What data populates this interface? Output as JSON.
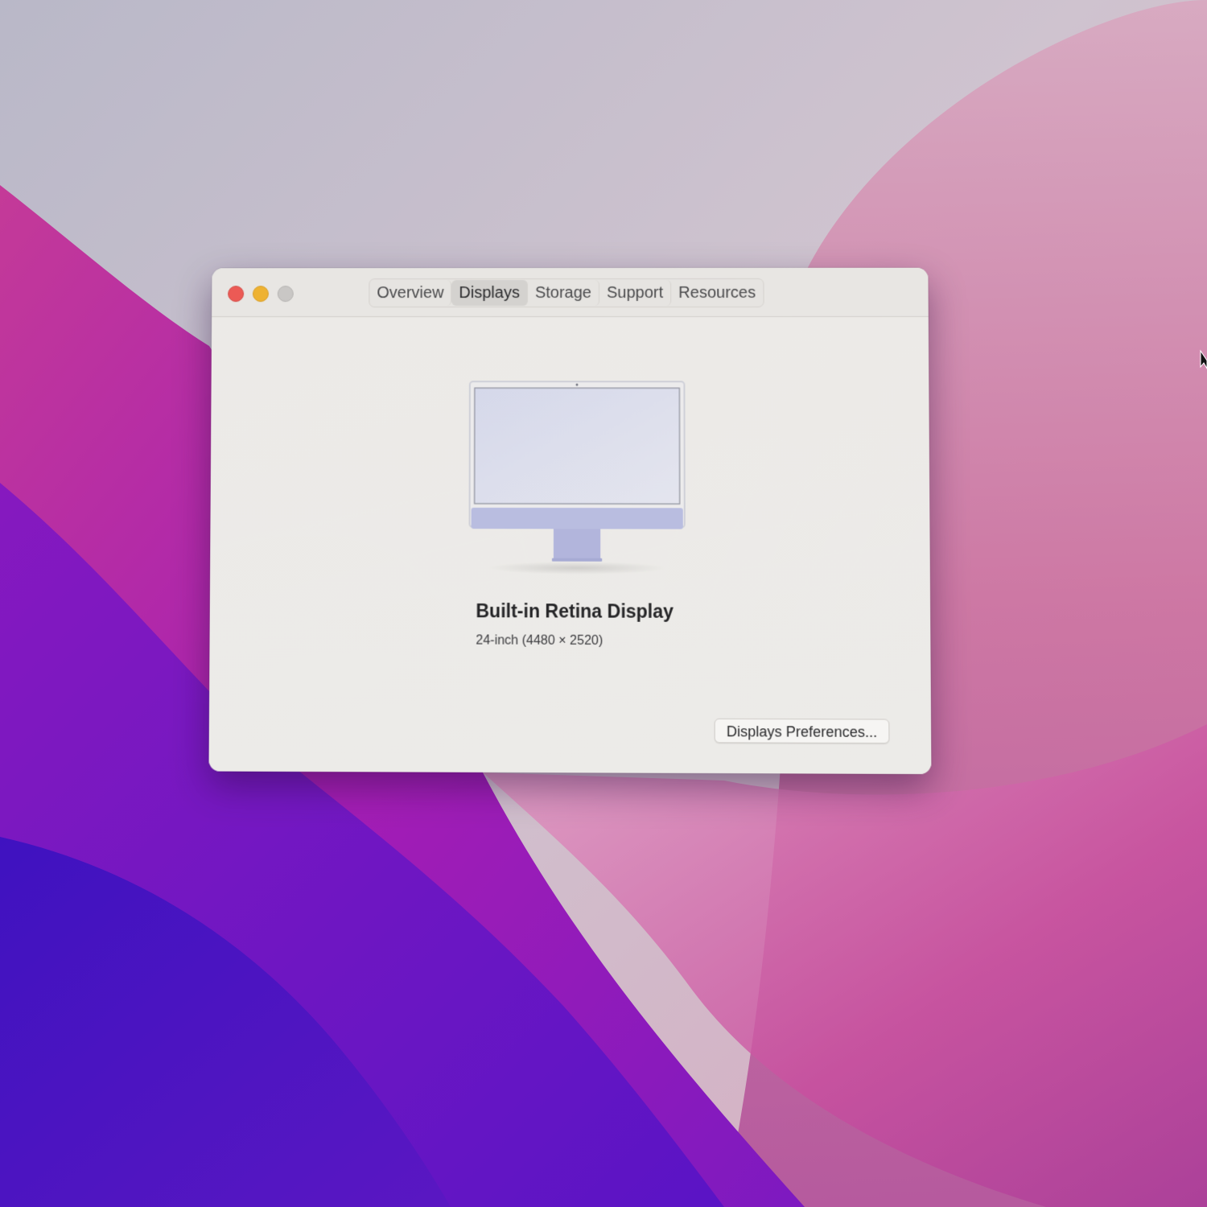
{
  "window": {
    "tabs": [
      {
        "label": "Overview",
        "active": false
      },
      {
        "label": "Displays",
        "active": true
      },
      {
        "label": "Storage",
        "active": false
      },
      {
        "label": "Support",
        "active": false
      },
      {
        "label": "Resources",
        "active": false
      }
    ],
    "traffic_lights": {
      "close_color": "#ec5a55",
      "minimize_color": "#eeb232",
      "zoom_color": "#c9c7c5"
    }
  },
  "display": {
    "icon": "imac-monitor-icon",
    "name": "Built-in Retina Display",
    "spec": "24-inch (4480 × 2520)",
    "accent_color": "#b9bde0"
  },
  "buttons": {
    "preferences_label": "Displays Preferences..."
  },
  "wallpaper": {
    "colors": [
      "#c9bfd0",
      "#d86aa7",
      "#a323b8",
      "#5d14c4",
      "#e48ab5"
    ]
  }
}
